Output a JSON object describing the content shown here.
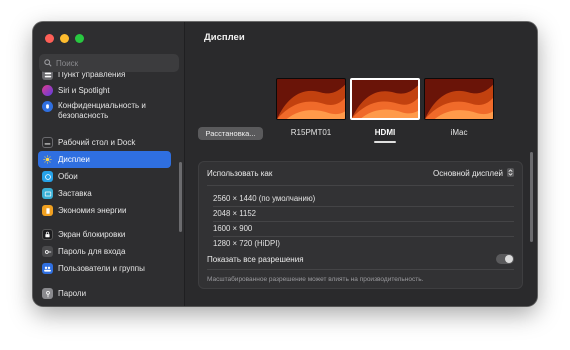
{
  "window": {
    "title": "Дисплеи"
  },
  "search": {
    "placeholder": "Поиск"
  },
  "sidebar": {
    "items": [
      {
        "label": "Пункт управления",
        "icon": "control-center-icon",
        "color": "#6a6a6e"
      },
      {
        "label": "Siri и Spotlight",
        "icon": "siri-icon",
        "color": "#c2338f"
      },
      {
        "label": "Конфиденциальность и безопасность",
        "icon": "hand-icon",
        "color": "#2f6fe0"
      },
      {
        "label": "Рабочий стол и Dock",
        "icon": "dock-icon",
        "color": "#2b2b2d"
      },
      {
        "label": "Дисплеи",
        "icon": "sun-icon",
        "color": "#2f6fe0"
      },
      {
        "label": "Обои",
        "icon": "wallpaper-icon",
        "color": "#26a2e8"
      },
      {
        "label": "Заставка",
        "icon": "screensaver-icon",
        "color": "#3ab0d6"
      },
      {
        "label": "Экономия энергии",
        "icon": "battery-icon",
        "color": "#f0a020"
      },
      {
        "label": "Экран блокировки",
        "icon": "lock-icon",
        "color": "#1c1c1e"
      },
      {
        "label": "Пароль для входа",
        "icon": "key-icon",
        "color": "#4a4a4c"
      },
      {
        "label": "Пользователи и группы",
        "icon": "users-icon",
        "color": "#2f6fe0"
      },
      {
        "label": "Пароли",
        "icon": "passwords-icon",
        "color": "#8a8a8e"
      }
    ]
  },
  "arrangement": {
    "button_label": "Расстановка..."
  },
  "displays": [
    {
      "name": "R15PMT01"
    },
    {
      "name": "HDMI"
    },
    {
      "name": "iMac"
    }
  ],
  "settings": {
    "use_as_label": "Использовать как",
    "use_as_value": "Основной дисплей",
    "resolutions": [
      "2560 × 1440 (по умолчанию)",
      "2048 × 1152",
      "1600 × 900",
      "1280 × 720 (HiDPI)"
    ],
    "show_all_label": "Показать все разрешения",
    "show_all_enabled": false,
    "footnote": "Масштабированное разрешение может влиять на производительность."
  },
  "colors": {
    "accent": "#2f6fe0",
    "wallpaper_orange": "#f06a2a",
    "wallpaper_dark": "#8a1c0a"
  }
}
